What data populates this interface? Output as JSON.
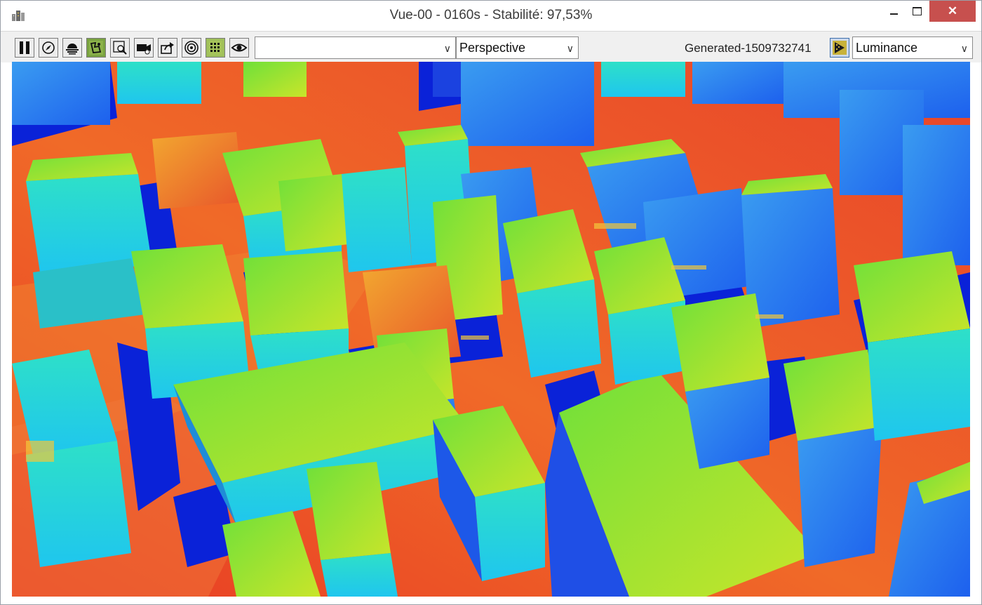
{
  "window": {
    "title": "Vue-00 - 0160s - Stabilité: 97,53%",
    "buttons": {
      "minimize": "minimize-button",
      "maximize": "maximize-button",
      "close": "✕"
    }
  },
  "toolbar": {
    "tools": [
      "pause-icon",
      "compass-icon",
      "sun-icon",
      "green-map-icon",
      "zoom-region-icon",
      "camera-record-icon",
      "export-icon",
      "target-icon",
      "grid-icon",
      "eye-icon"
    ],
    "view_selector": {
      "value": ""
    },
    "projection_selector": {
      "value": "Perspective"
    },
    "generated_label": "Generated-1509732741",
    "display_mode_selector": {
      "value": "Luminance"
    }
  },
  "viewport": {
    "description_colors": {
      "ground_high": "#e8442a",
      "ground_mid": "#f07d2a",
      "roof": "#7fe02a",
      "wall_cyan": "#22d6e8",
      "wall_blue": "#1f6cf0",
      "shadow": "#0a22d8"
    }
  }
}
